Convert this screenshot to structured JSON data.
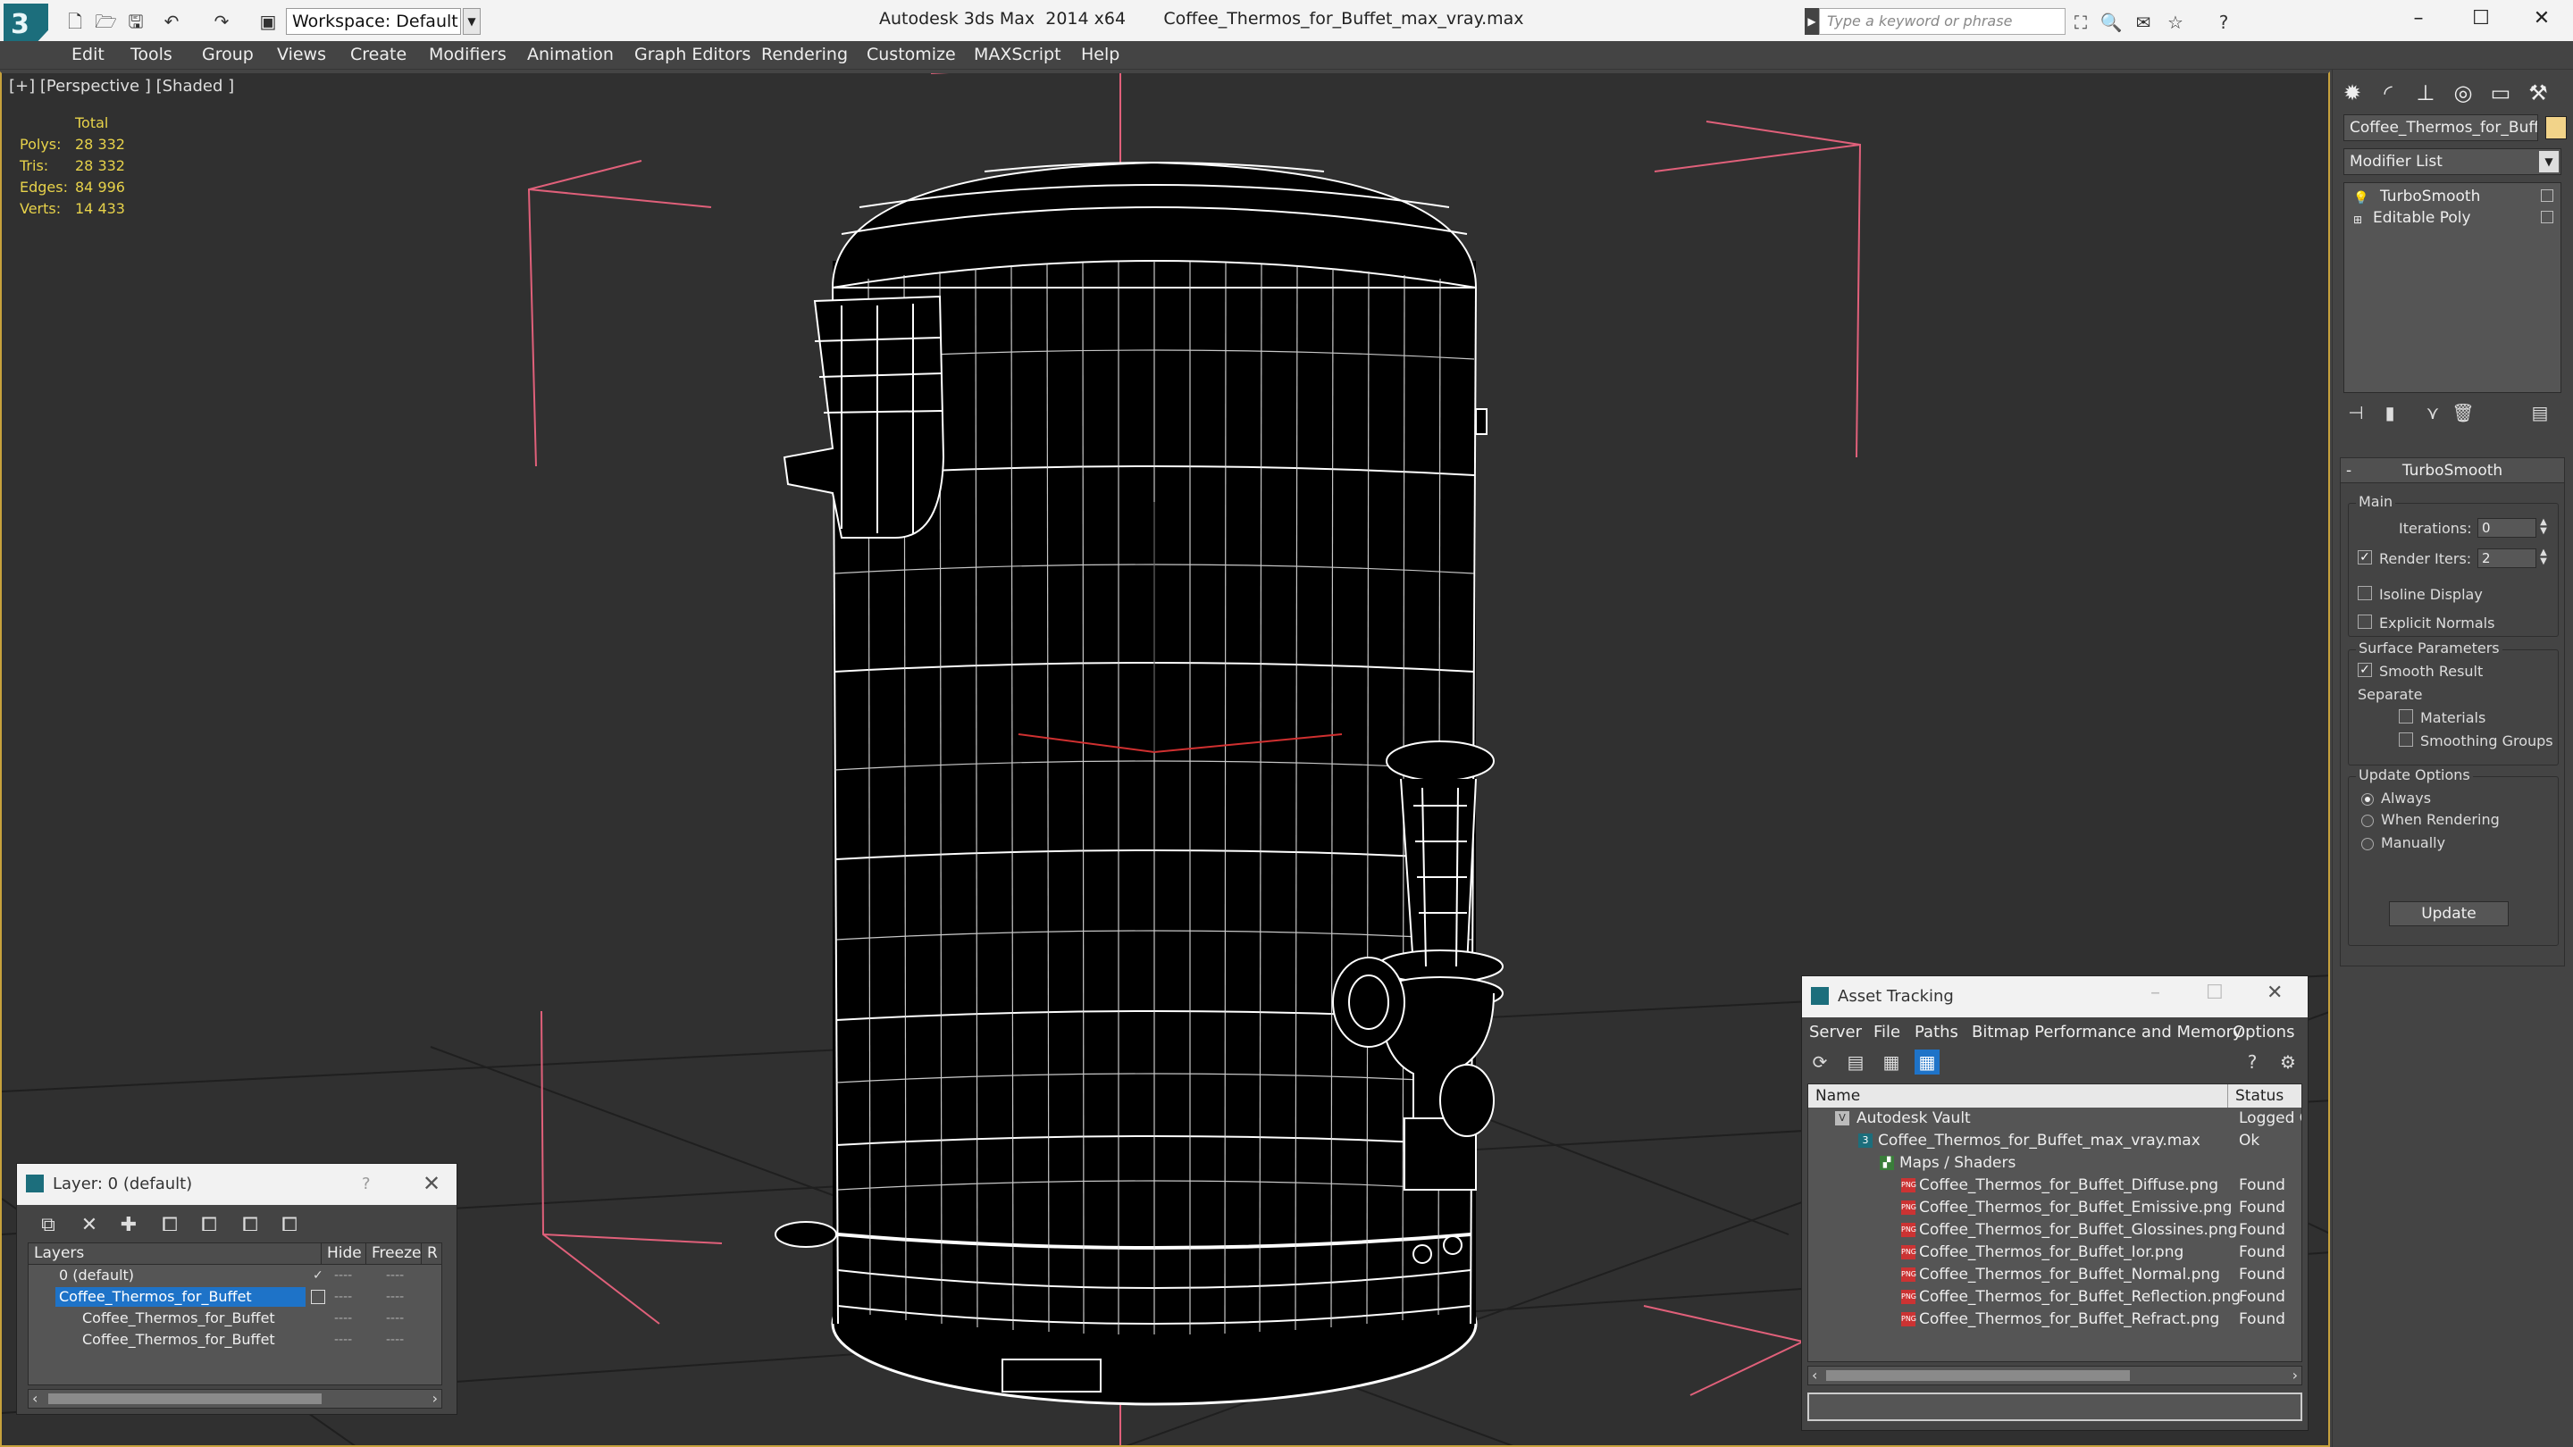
{
  "titlebar": {
    "app_logo": "3",
    "workspace": "Workspace: Default",
    "title": "Autodesk 3ds Max  2014 x64       Coffee_Thermos_for_Buffet_max_vray.max",
    "search_placeholder": "Type a keyword or phrase",
    "icons": [
      "new-icon",
      "open-icon",
      "save-icon",
      "undo-icon",
      "redo-icon",
      "project-icon"
    ],
    "right_icons": [
      "binoculars-icon",
      "search-icon",
      "communication-icon",
      "favorites-icon",
      "help-icon"
    ],
    "window_buttons": [
      "–",
      "☐",
      "✕"
    ]
  },
  "menu": [
    "Edit",
    "Tools",
    "Group",
    "Views",
    "Create",
    "Modifiers",
    "Animation",
    "Graph Editors",
    "Rendering",
    "Customize",
    "MAXScript",
    "Help"
  ],
  "viewport": {
    "label": "[+] [Perspective ] [Shaded ]",
    "stats": {
      "header": "Total",
      "rows": [
        {
          "k": "Polys:",
          "v": "28 332"
        },
        {
          "k": "Tris:",
          "v": "28 332"
        },
        {
          "k": "Edges:",
          "v": "84 996"
        },
        {
          "k": "Verts:",
          "v": "14 433"
        }
      ]
    },
    "colors": {
      "background": "#303030",
      "grid": "#1f1f1f",
      "bracket": "#e0607a",
      "wire": "#ffffff",
      "axis_red": "#d03030"
    }
  },
  "command_panel": {
    "object_name": "Coffee_Thermos_for_Buffet",
    "object_color": "#f2d389",
    "modifier_list": "Modifier List",
    "stack": [
      "TurboSmooth",
      "Editable Poly"
    ],
    "rollout": {
      "title": "TurboSmooth",
      "main": "Main",
      "iterations_label": "Iterations:",
      "iterations": "0",
      "render_iters_label": "Render Iters:",
      "render_iters": "2",
      "isoline": "Isoline Display",
      "explicit": "Explicit Normals",
      "surface": "Surface Parameters",
      "smooth_result": "Smooth Result",
      "separate": "Separate",
      "materials": "Materials",
      "smoothing_groups": "Smoothing Groups",
      "update_options": "Update Options",
      "always": "Always",
      "when_rendering": "When Rendering",
      "manually": "Manually",
      "update": "Update"
    }
  },
  "layer_dialog": {
    "title": "Layer: 0 (default)",
    "help": "?",
    "headers": [
      "Layers",
      "Hide",
      "Freeze",
      "R"
    ],
    "rows": [
      {
        "name": "0 (default)",
        "selected": false
      },
      {
        "name": "Coffee_Thermos_for_Buffet",
        "selected": true
      },
      {
        "name": "Coffee_Thermos_for_Buffet",
        "selected": false
      },
      {
        "name": "Coffee_Thermos_for_Buffet",
        "selected": false
      }
    ],
    "dash": "----"
  },
  "asset_tracking": {
    "title": "Asset Tracking",
    "menu": [
      "Server",
      "File",
      "Paths",
      "Bitmap Performance and Memory",
      "Options"
    ],
    "headers": [
      "Name",
      "Status"
    ],
    "rows": [
      {
        "name": "Autodesk Vault",
        "status": "Logged O"
      },
      {
        "name": "Coffee_Thermos_for_Buffet_max_vray.max",
        "status": "Ok"
      },
      {
        "name": "Maps / Shaders",
        "status": ""
      },
      {
        "name": "Coffee_Thermos_for_Buffet_Diffuse.png",
        "status": "Found"
      },
      {
        "name": "Coffee_Thermos_for_Buffet_Emissive.png",
        "status": "Found"
      },
      {
        "name": "Coffee_Thermos_for_Buffet_Glossines.png",
        "status": "Found"
      },
      {
        "name": "Coffee_Thermos_for_Buffet_Ior.png",
        "status": "Found"
      },
      {
        "name": "Coffee_Thermos_for_Buffet_Normal.png",
        "status": "Found"
      },
      {
        "name": "Coffee_Thermos_for_Buffet_Reflection.png",
        "status": "Found"
      },
      {
        "name": "Coffee_Thermos_for_Buffet_Refract.png",
        "status": "Found"
      }
    ]
  }
}
